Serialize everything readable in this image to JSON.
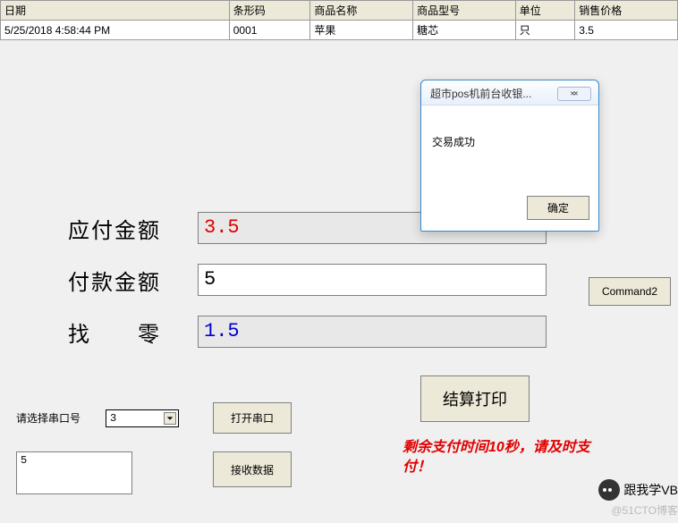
{
  "table": {
    "headers": [
      "日期",
      "条形码",
      "商品名称",
      "商品型号",
      "单位",
      "销售价格"
    ],
    "row": [
      "5/25/2018 4:58:44 PM",
      "0001",
      "苹果",
      "糖芯",
      "只",
      "3.5"
    ]
  },
  "payment": {
    "due_label": "应付金额",
    "due_value": "3.5",
    "paid_label": "付款金额",
    "paid_value": "5",
    "change_label": "找　　零",
    "change_value": "1.5"
  },
  "side_button": "Command2",
  "settle_button": "结算打印",
  "countdown": "剩余支付时间10秒，请及时支付！",
  "port": {
    "label": "请选择串口号",
    "selected": "3",
    "open_label": "打开串口",
    "recv_label": "接收数据",
    "recv_value": "5"
  },
  "modal": {
    "title": "超市pos机前台收银...",
    "message": "交易成功",
    "ok": "确定"
  },
  "watermark": {
    "brand": "跟我学VB",
    "sub": "@51CTO博客"
  }
}
